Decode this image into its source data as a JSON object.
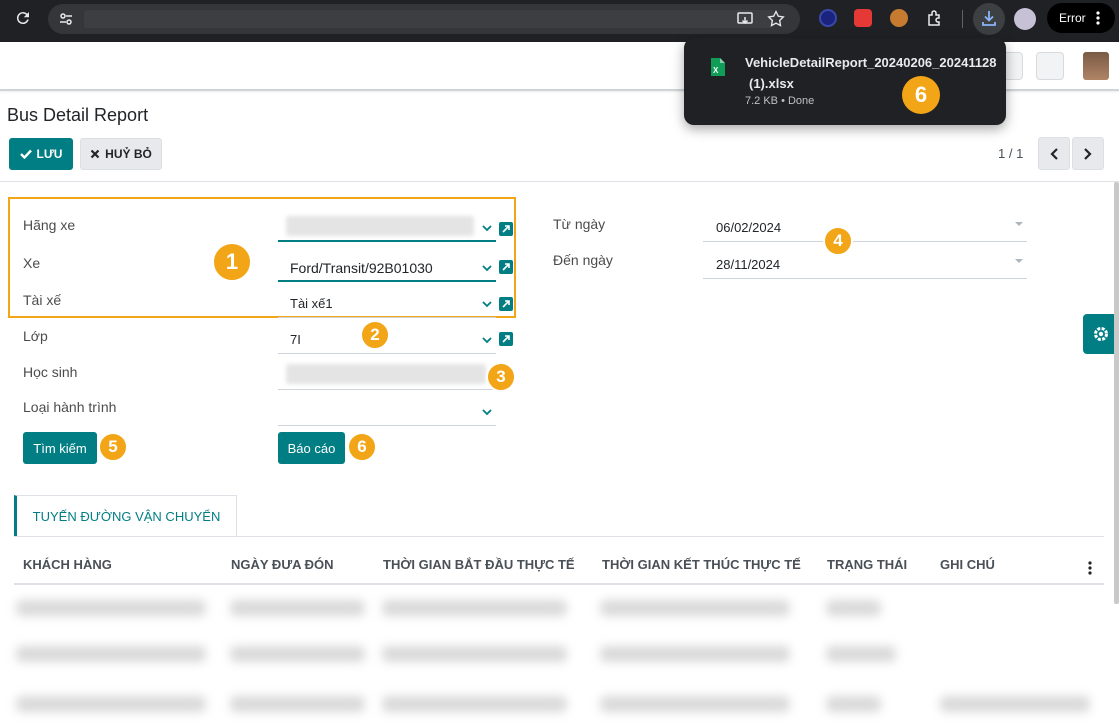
{
  "browser": {
    "error_label": "Error"
  },
  "download": {
    "filename_line1": "VehicleDetailReport_20240206_20241128",
    "filename_line2": "(1).xlsx",
    "meta": "7.2 KB • Done"
  },
  "page": {
    "title": "Bus Detail Report",
    "save_label": "LƯU",
    "cancel_label": "HUỶ BỎ",
    "pager": "1 / 1"
  },
  "form": {
    "brand_label": "Hãng xe",
    "vehicle_label": "Xe",
    "vehicle_value": "Ford/Transit/92B01030",
    "driver_label": "Tài xế",
    "driver_value": "Tài xế1",
    "class_label": "Lớp",
    "class_value": "7I",
    "student_label": "Học sinh",
    "route_type_label": "Loại hành trình",
    "from_date_label": "Từ ngày",
    "from_date_value": "06/02/2024",
    "to_date_label": "Đến ngày",
    "to_date_value": "28/11/2024",
    "search_label": "Tìm kiếm",
    "report_label": "Báo cáo"
  },
  "badges": {
    "b1": "1",
    "b2": "2",
    "b3": "3",
    "b4": "4",
    "b5": "5",
    "b6": "6",
    "b6_popup": "6"
  },
  "tab": {
    "label": "TUYẾN ĐƯỜNG VẬN CHUYỂN"
  },
  "table": {
    "columns": [
      "KHÁCH HÀNG",
      "NGÀY ĐƯA ĐÓN",
      "THỜI GIAN BẮT ĐẦU THỰC TẾ",
      "THỜI GIAN KẾT THÚC THỰC TẾ",
      "TRẠNG THÁI",
      "GHI CHÚ"
    ]
  },
  "colors": {
    "primary": "#017e84",
    "highlight": "#f2a516",
    "chrome": "#202124"
  }
}
